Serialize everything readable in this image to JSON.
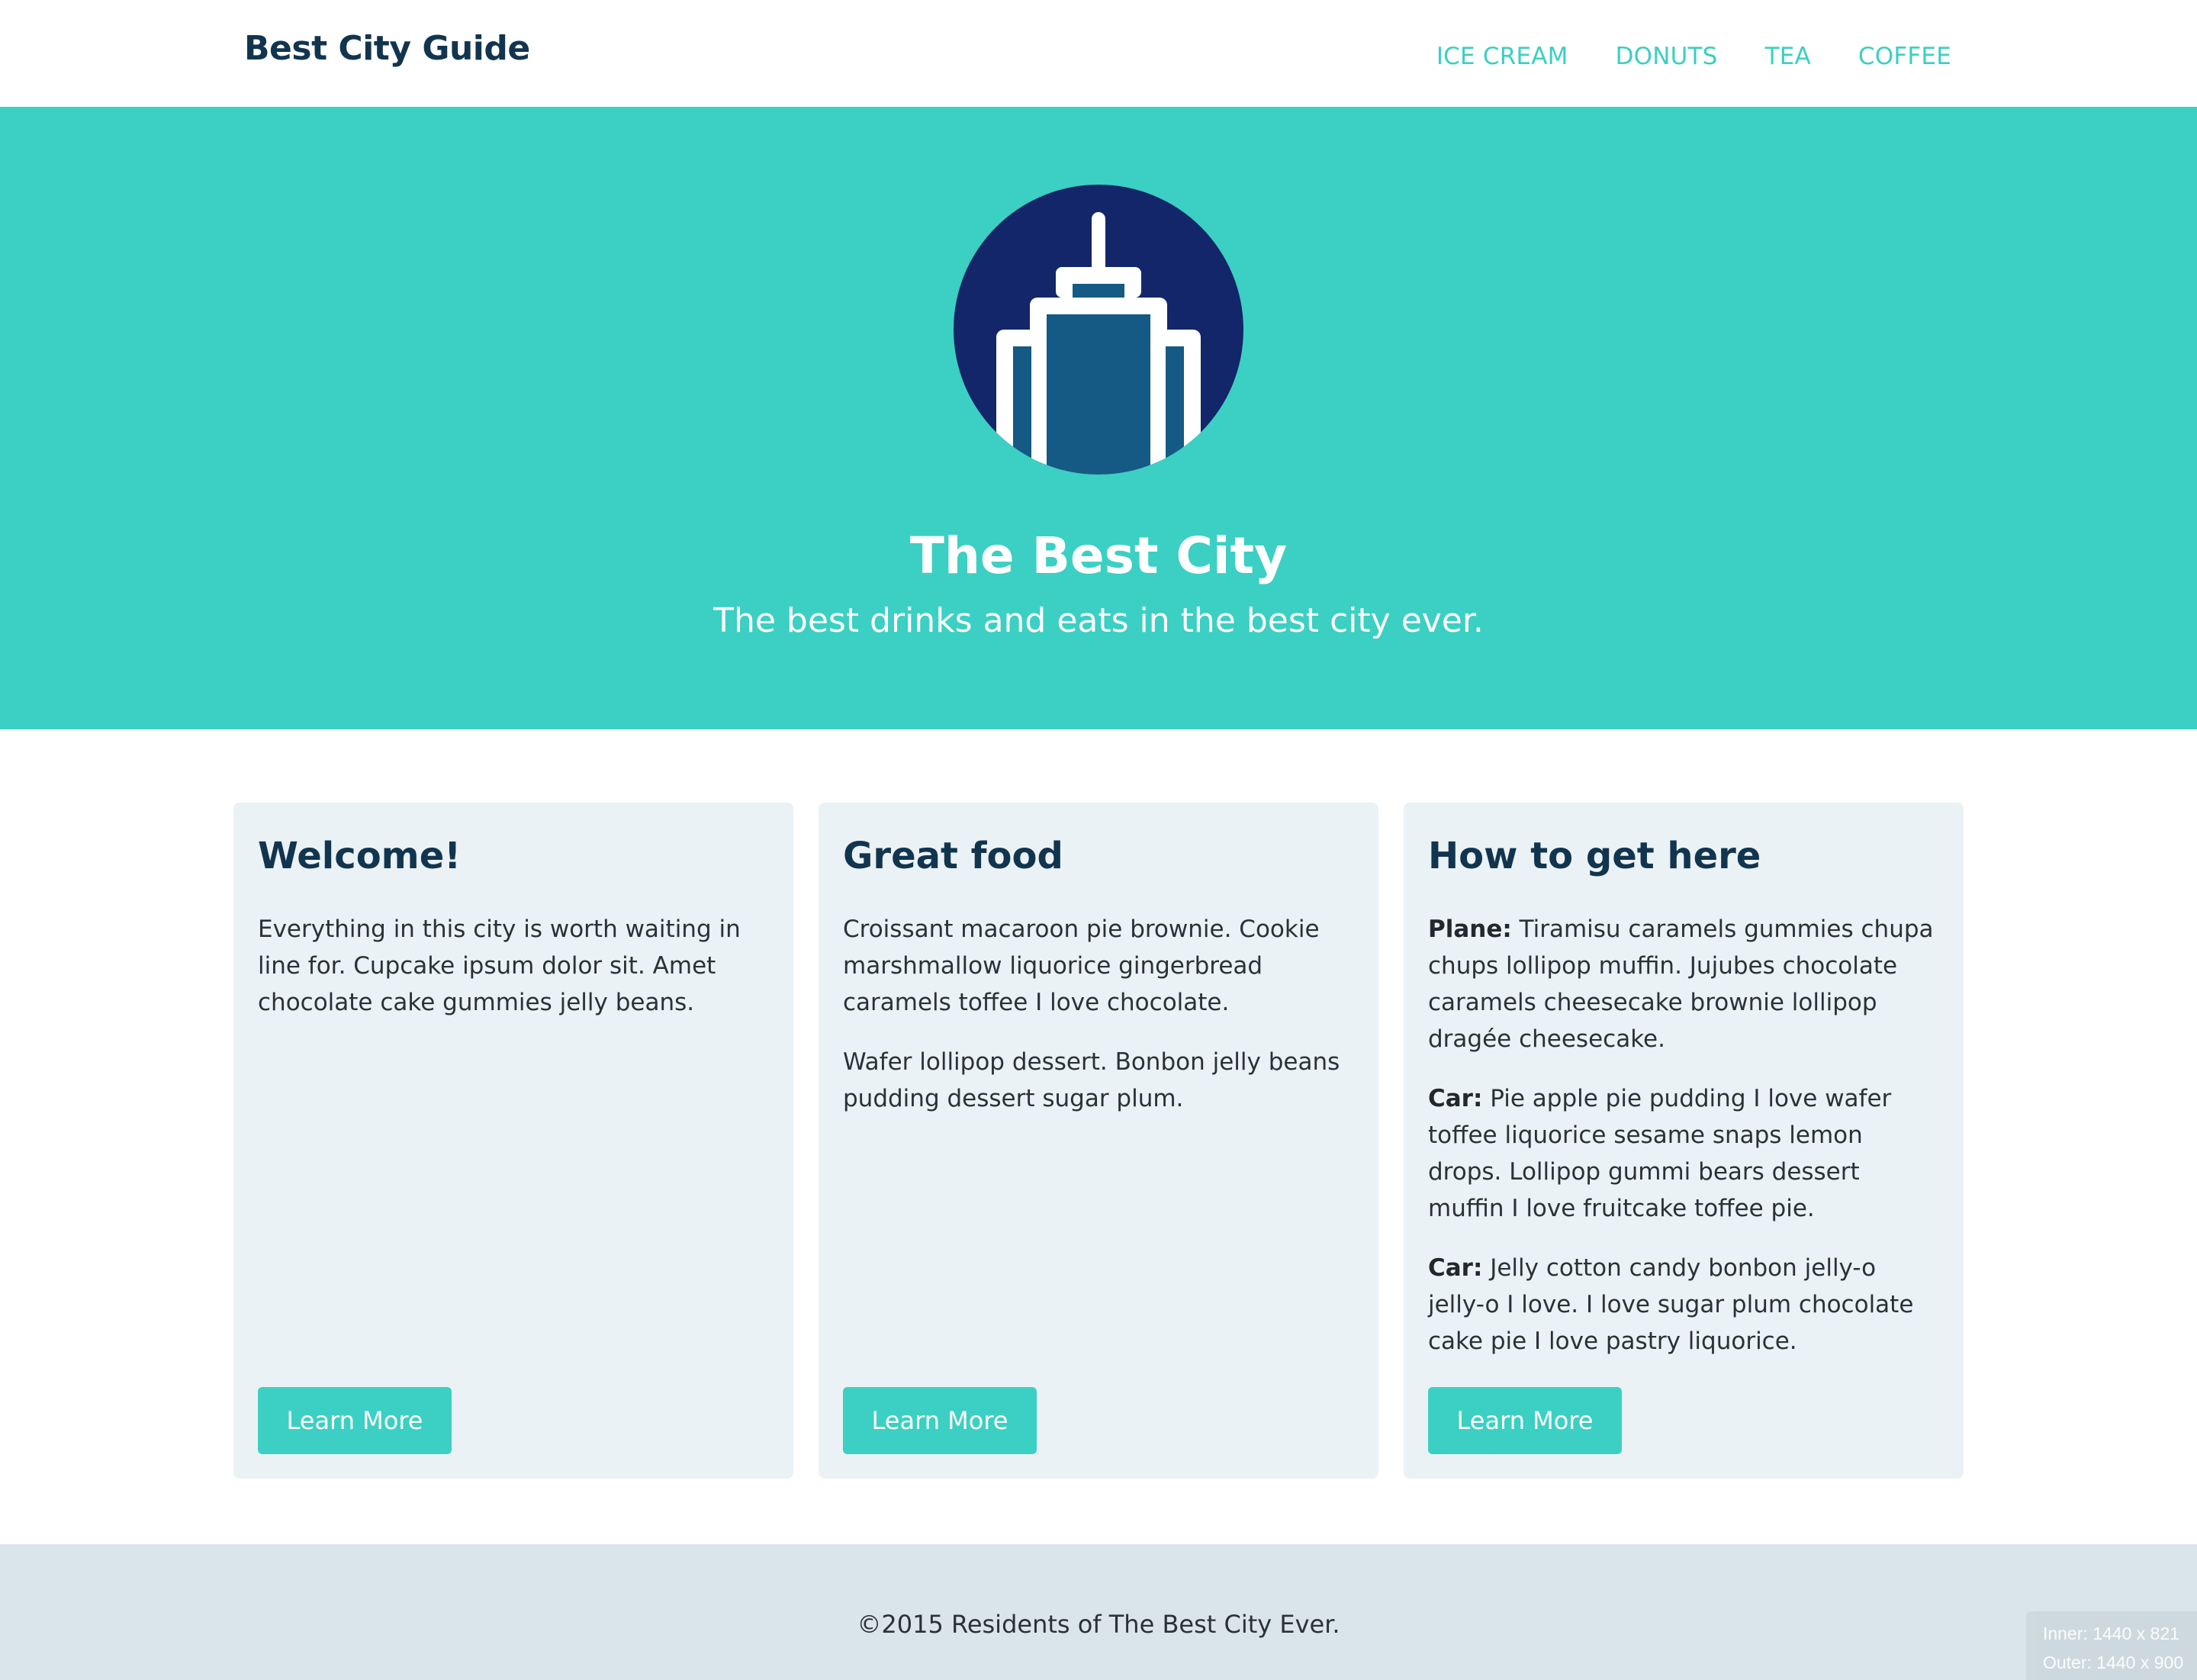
{
  "header": {
    "brand": "Best City Guide",
    "nav": [
      "ICE CREAM",
      "DONUTS",
      "TEA",
      "COFFEE"
    ]
  },
  "hero": {
    "logo_icon": "skyscraper-icon",
    "title": "The Best City",
    "subtitle": "The best drinks and eats in the best city ever."
  },
  "cards": [
    {
      "title": "Welcome!",
      "paragraphs": [
        {
          "label": "",
          "text": "Everything in this city is worth waiting in line for. Cupcake ipsum dolor sit. Amet chocolate cake gummies jelly beans."
        }
      ],
      "button": "Learn More"
    },
    {
      "title": "Great food",
      "paragraphs": [
        {
          "label": "",
          "text": "Croissant macaroon pie brownie. Cookie marshmallow liquorice gingerbread caramels toffee I love chocolate."
        },
        {
          "label": "",
          "text": "Wafer lollipop dessert. Bonbon jelly beans pudding dessert sugar plum."
        }
      ],
      "button": "Learn More"
    },
    {
      "title": "How to get here",
      "paragraphs": [
        {
          "label": "Plane:",
          "text": " Tiramisu caramels gummies chupa chups lollipop muffin. Jujubes chocolate caramels cheesecake brownie lollipop dragée cheesecake."
        },
        {
          "label": "Car:",
          "text": " Pie apple pie pudding I love wafer toffee liquorice sesame snaps lemon drops. Lollipop gummi bears dessert muffin I love fruitcake toffee pie."
        },
        {
          "label": "Car:",
          "text": " Jelly cotton candy bonbon jelly-o jelly-o I love. I love sugar plum chocolate cake pie I love pastry liquorice."
        }
      ],
      "button": "Learn More"
    }
  ],
  "footer": {
    "text": "©2015 Residents of The Best City Ever."
  },
  "overlay": {
    "inner": "Inner: 1440 x 821",
    "outer": "Outer: 1440 x 900"
  },
  "colors": {
    "accent": "#3bd0c3",
    "brand_text": "#12354f",
    "card_bg": "#ebf2f6",
    "footer_bg": "#dae5eb",
    "logo_circle": "#13266a",
    "logo_building": "#145a84"
  }
}
